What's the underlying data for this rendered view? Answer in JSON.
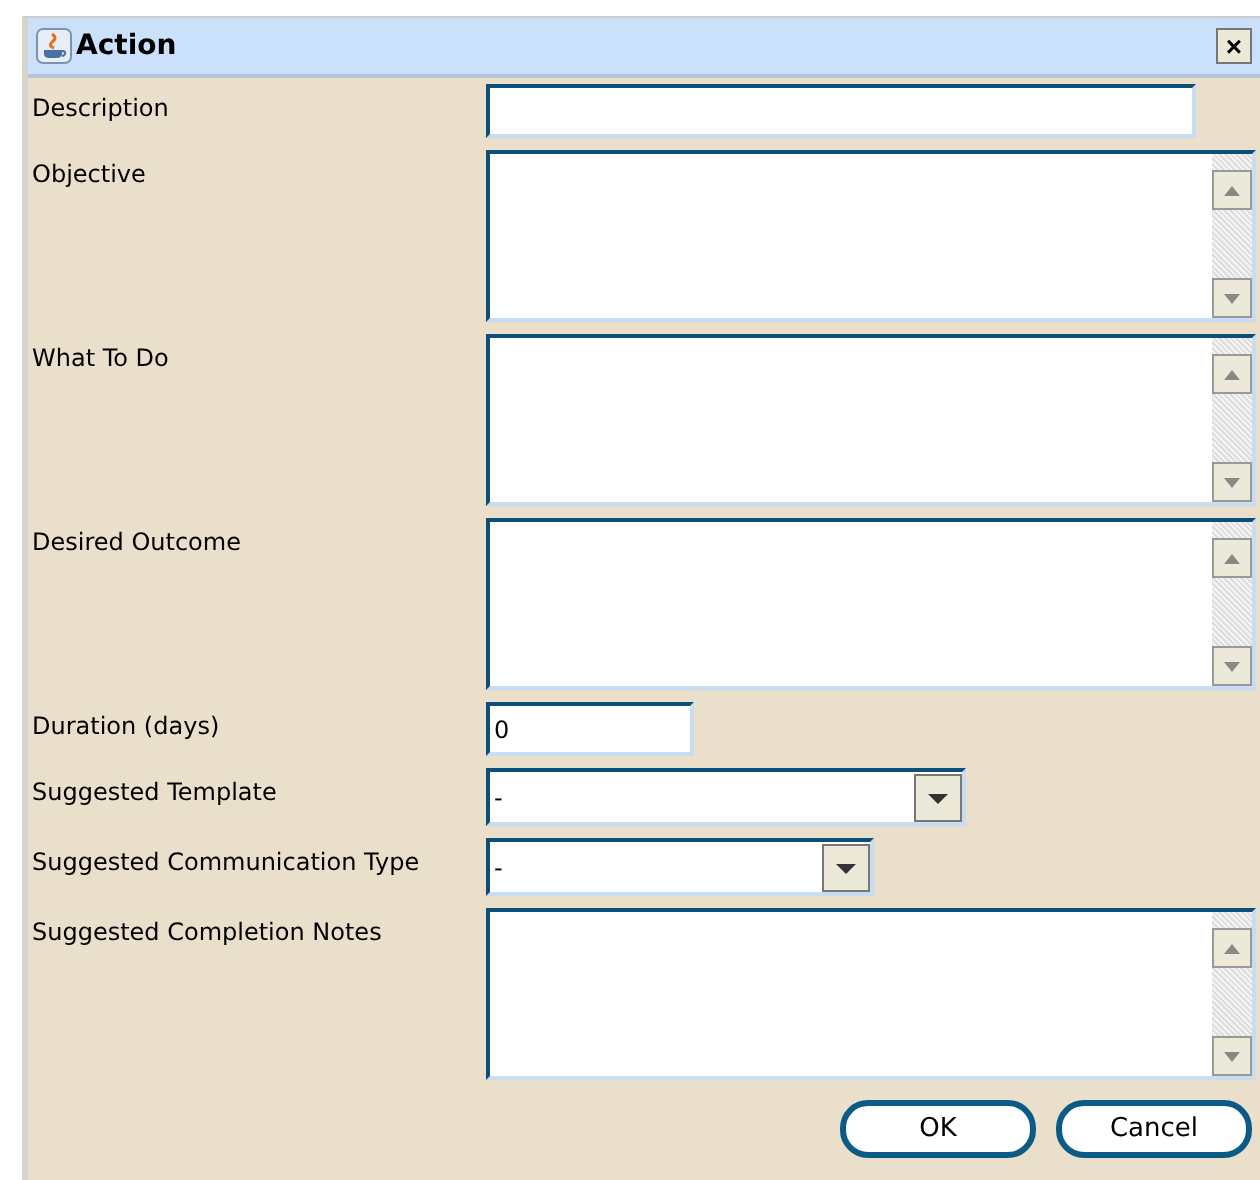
{
  "window": {
    "title": "Action",
    "close_glyph": "×"
  },
  "fields": [
    {
      "label": "Description",
      "kind": "text"
    },
    {
      "label": "Objective",
      "kind": "textarea"
    },
    {
      "label": "What To Do",
      "kind": "textarea"
    },
    {
      "label": "Desired Outcome",
      "kind": "textarea"
    },
    {
      "label": "Duration (days)",
      "kind": "short",
      "value": "0"
    },
    {
      "label": "Suggested Template",
      "kind": "dropdown",
      "value": "-"
    },
    {
      "label": "Suggested Communication Type",
      "kind": "dropdown",
      "value": "-"
    },
    {
      "label": "Suggested Completion Notes",
      "kind": "textarea"
    }
  ],
  "buttons": [
    "OK",
    "Cancel"
  ]
}
